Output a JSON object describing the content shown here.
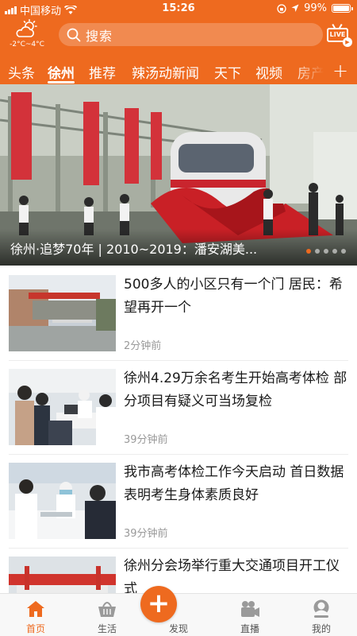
{
  "status_bar": {
    "carrier": "中国移动",
    "time": "15:26",
    "battery": "99%",
    "battery_level": 0.99
  },
  "header": {
    "weather_icon": "partly-cloudy-icon",
    "weather_temp": "-2°C~4°C",
    "search_placeholder": "搜索",
    "live_label": "LIVE"
  },
  "tabs": [
    {
      "label": "头条"
    },
    {
      "label": "徐州",
      "active": true
    },
    {
      "label": "推荐"
    },
    {
      "label": "辣汤动新闻"
    },
    {
      "label": "天下"
    },
    {
      "label": "视频"
    },
    {
      "label": "房产"
    }
  ],
  "hero": {
    "title": "徐州·追梦70年 | 2010~2019：潘安湖美...",
    "slides": 5,
    "active_slide": 1
  },
  "news": [
    {
      "title": "500多人的小区只有一个门  居民：希望再开一个",
      "time": "2分钟前"
    },
    {
      "title": "徐州4.29万余名考生开始高考体检  部分项目有疑义可当场复检",
      "time": "39分钟前"
    },
    {
      "title": "我市高考体检工作今天启动 首日数据表明考生身体素质良好",
      "time": "39分钟前"
    },
    {
      "title": "徐州分会场举行重大交通项目开工仪式",
      "time": ""
    }
  ],
  "bottom_nav": [
    {
      "label": "首页",
      "icon": "home-icon",
      "active": true
    },
    {
      "label": "生活",
      "icon": "basket-icon"
    },
    {
      "label": "发现",
      "icon": "plus-icon"
    },
    {
      "label": "直播",
      "icon": "video-camera-icon"
    },
    {
      "label": "我的",
      "icon": "user-icon"
    }
  ],
  "colors": {
    "accent": "#ee6a1f",
    "text": "#1a1a1a",
    "muted": "#999999"
  }
}
